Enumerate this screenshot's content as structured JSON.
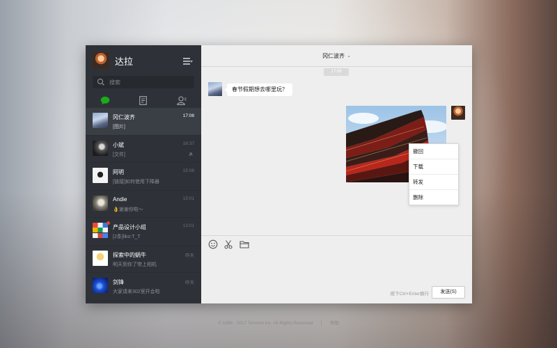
{
  "profile": {
    "name": "达拉"
  },
  "search": {
    "placeholder": "搜索"
  },
  "tabs": [
    {
      "icon": "chat-bubble-icon",
      "active": true
    },
    {
      "icon": "document-icon",
      "active": false
    },
    {
      "icon": "contacts-icon",
      "active": false
    }
  ],
  "conversations": [
    {
      "name": "冈仁波齐",
      "message": "[图片]",
      "time": "17:08",
      "active": true
    },
    {
      "name": "小斌",
      "message": "[文件]",
      "time": "16:37",
      "muted": true
    },
    {
      "name": "阿明",
      "message": "[链接]如何使用下降器",
      "time": "15:08"
    },
    {
      "name": "Andie",
      "message": "👌谢谢你啦～",
      "time": "15:01"
    },
    {
      "name": "产品设计小组",
      "message": "[2条]liko:T_T",
      "time": "13:01",
      "unread_dot": true
    },
    {
      "name": "探索中的蜗牛",
      "message": "明天到你了带上相机",
      "time": "昨天"
    },
    {
      "name": "剑锋",
      "message": "大家请来302室开会啦",
      "time": "昨天"
    }
  ],
  "chat": {
    "title": "冈仁波齐",
    "time_separator": "17:08",
    "incoming_message": "春节假期想去哪里玩？"
  },
  "context_menu": [
    "撤回",
    "下载",
    "转发",
    "删除"
  ],
  "composer": {
    "hint": "按下Ctrl+Enter换行",
    "send_label": "发送(S)"
  },
  "footer": {
    "copyright": "© 1998 - 2017 Tencent Inc. All Rights Reserved",
    "help": "帮助"
  },
  "colors": {
    "accent_green": "#1aad19",
    "sidebar_bg": "#2e3238",
    "chat_bg": "#eeeeee"
  }
}
